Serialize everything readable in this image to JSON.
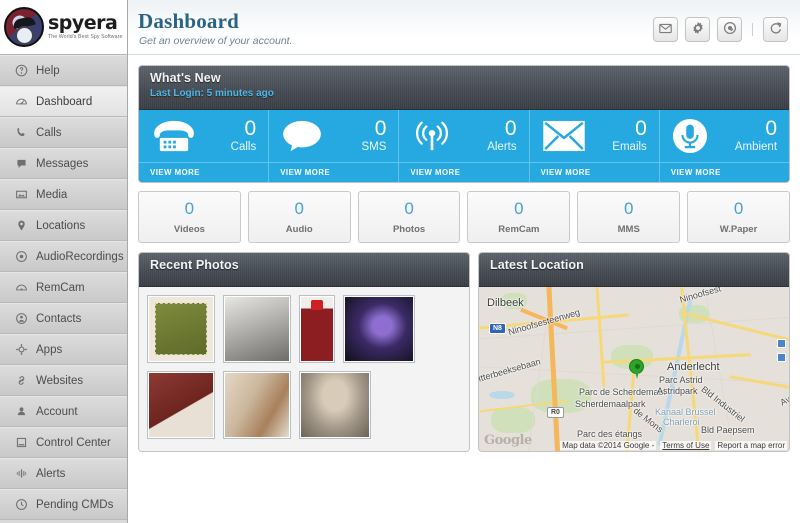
{
  "brand": {
    "name": "spyera",
    "tagline": "The World's Best Spy Software",
    "logo_icon": "spy-detective-logo-icon"
  },
  "sidebar": {
    "items": [
      {
        "label": "Help",
        "icon": "help-icon",
        "active": false
      },
      {
        "label": "Dashboard",
        "icon": "dashboard-icon",
        "active": true
      },
      {
        "label": "Calls",
        "icon": "phone-icon",
        "active": false
      },
      {
        "label": "Messages",
        "icon": "message-bubble-icon",
        "active": false
      },
      {
        "label": "Media",
        "icon": "media-image-icon",
        "active": false
      },
      {
        "label": "Locations",
        "icon": "map-pin-icon",
        "active": false
      },
      {
        "label": "AudioRecordings",
        "icon": "audio-disc-icon",
        "active": false
      },
      {
        "label": "RemCam",
        "icon": "camera-icon",
        "active": false
      },
      {
        "label": "Contacts",
        "icon": "contacts-icon",
        "active": false
      },
      {
        "label": "Apps",
        "icon": "apps-gear-icon",
        "active": false
      },
      {
        "label": "Websites",
        "icon": "link-icon",
        "active": false
      },
      {
        "label": "Account",
        "icon": "user-icon",
        "active": false
      },
      {
        "label": "Control Center",
        "icon": "control-panel-icon",
        "active": false
      },
      {
        "label": "Alerts",
        "icon": "alert-signal-icon",
        "active": false
      },
      {
        "label": "Pending CMDs",
        "icon": "pending-clock-icon",
        "active": false
      }
    ]
  },
  "header": {
    "title": "Dashboard",
    "subtitle": "Get an overview of your account.",
    "actions": [
      {
        "name": "messages-button",
        "icon": "envelope-icon"
      },
      {
        "name": "settings-button",
        "icon": "gear-icon"
      },
      {
        "name": "search-button",
        "icon": "at-search-icon"
      },
      {
        "name": "refresh-button",
        "icon": "refresh-icon"
      }
    ]
  },
  "whats_new": {
    "title": "What's New",
    "last_login": "Last Login: 5 minutes ago",
    "view_more_label": "VIEW MORE",
    "tiles": [
      {
        "label": "Calls",
        "value": "0",
        "icon": "telephone-icon"
      },
      {
        "label": "SMS",
        "value": "0",
        "icon": "speech-bubble-icon"
      },
      {
        "label": "Alerts",
        "value": "0",
        "icon": "broadcast-antenna-icon"
      },
      {
        "label": "Emails",
        "value": "0",
        "icon": "envelope-icon"
      },
      {
        "label": "Ambient",
        "value": "0",
        "icon": "microphone-icon"
      }
    ]
  },
  "ministats": [
    {
      "label": "Videos",
      "value": "0"
    },
    {
      "label": "Audio",
      "value": "0"
    },
    {
      "label": "Photos",
      "value": "0"
    },
    {
      "label": "RemCam",
      "value": "0"
    },
    {
      "label": "MMS",
      "value": "0"
    },
    {
      "label": "W.Paper",
      "value": "0"
    }
  ],
  "recent_photos": {
    "title": "Recent Photos",
    "thumbnails": [
      {
        "name": "thumb-vintage-banner"
      },
      {
        "name": "thumb-desk-tools-bw"
      },
      {
        "name": "thumb-red-gas-pump"
      },
      {
        "name": "thumb-tablet-device"
      },
      {
        "name": "thumb-red-leather-bag"
      },
      {
        "name": "thumb-vintage-collage"
      },
      {
        "name": "thumb-girl-portrait"
      }
    ]
  },
  "latest_location": {
    "title": "Latest Location",
    "map": {
      "provider": "Google",
      "labels": [
        "Dilbeek",
        "Ninoofsesteenweg",
        "Ninoofsest",
        "Itterbeeksebaan",
        "Anderlecht",
        "Parc de Scherdemael",
        "Scherdemaalpark",
        "Parc Astrid",
        "Astridpark",
        "Kanaal Brussel",
        "Charleroi",
        "Bld Industriel",
        "Bld Paepsem",
        "Parc des étangs",
        "Avenue",
        "de Mons"
      ],
      "highway_badge": "N8",
      "road_badge": "R0",
      "attribution": "Map data ©2014 Google -",
      "terms_label": "Terms of Use",
      "report_label": "Report a map error",
      "logo_text": "Google"
    }
  },
  "colors": {
    "accent_blue": "#26a9e0",
    "panel_header": "#464c54",
    "title_blue": "#2a6384",
    "sidebar_bg": "#d9d9d9",
    "marker_green": "#2aa52a"
  }
}
